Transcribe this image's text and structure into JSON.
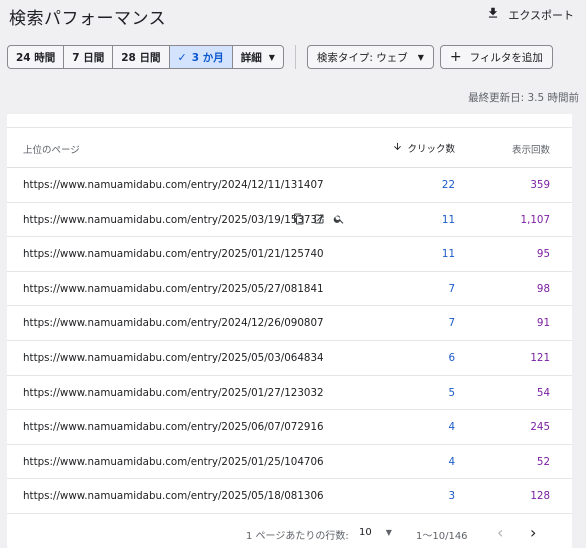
{
  "header": {
    "title": "検索パフォーマンス",
    "export_label": "エクスポート"
  },
  "filters": {
    "date_ranges": [
      {
        "label": "24 時間",
        "active": false
      },
      {
        "label": "7 日間",
        "active": false
      },
      {
        "label": "28 日間",
        "active": false
      },
      {
        "label": "3 か月",
        "active": true
      },
      {
        "label": "詳細",
        "active": false
      }
    ],
    "search_type": "検索タイプ: ウェブ",
    "add_filter": "フィルタを追加"
  },
  "last_updated": "最終更新日: 3.5 時間前",
  "table": {
    "columns": {
      "page": "上位のページ",
      "clicks": "クリック数",
      "impressions": "表示回数"
    },
    "rows": [
      {
        "url": "https://www.namuamidabu.com/entry/2024/12/11/131407",
        "clicks": "22",
        "impressions": "359"
      },
      {
        "url": "https://www.namuamidabu.com/entry/2025/03/19/153737",
        "clicks": "11",
        "impressions": "1,107"
      },
      {
        "url": "https://www.namuamidabu.com/entry/2025/01/21/125740",
        "clicks": "11",
        "impressions": "95"
      },
      {
        "url": "https://www.namuamidabu.com/entry/2025/05/27/081841",
        "clicks": "7",
        "impressions": "98"
      },
      {
        "url": "https://www.namuamidabu.com/entry/2024/12/26/090807",
        "clicks": "7",
        "impressions": "91"
      },
      {
        "url": "https://www.namuamidabu.com/entry/2025/05/03/064834",
        "clicks": "6",
        "impressions": "121"
      },
      {
        "url": "https://www.namuamidabu.com/entry/2025/01/27/123032",
        "clicks": "5",
        "impressions": "54"
      },
      {
        "url": "https://www.namuamidabu.com/entry/2025/06/07/072916",
        "clicks": "4",
        "impressions": "245"
      },
      {
        "url": "https://www.namuamidabu.com/entry/2025/01/25/104706",
        "clicks": "4",
        "impressions": "52"
      },
      {
        "url": "https://www.namuamidabu.com/entry/2025/05/18/081306",
        "clicks": "3",
        "impressions": "128"
      }
    ]
  },
  "pagination": {
    "rows_per_page_label": "1 ページあたりの行数:",
    "rows_per_page": "10",
    "range": "1〜10/146"
  },
  "colors": {
    "clicks": "#1a5ac8",
    "impressions": "#7b1fa2",
    "active_chip_bg": "#d3e3fd"
  }
}
